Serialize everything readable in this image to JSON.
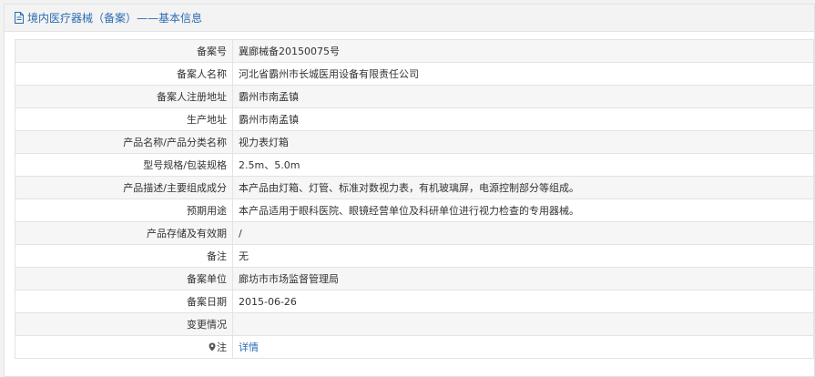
{
  "header": {
    "title": "境内医疗器械（备案）——基本信息"
  },
  "rows": [
    {
      "label": "备案号",
      "value": "冀廊械备20150075号"
    },
    {
      "label": "备案人名称",
      "value": "河北省霸州市长城医用设备有限责任公司"
    },
    {
      "label": "备案人注册地址",
      "value": "霸州市南孟镇"
    },
    {
      "label": "生产地址",
      "value": "霸州市南孟镇"
    },
    {
      "label": "产品名称/产品分类名称",
      "value": "视力表灯箱"
    },
    {
      "label": "型号规格/包装规格",
      "value": "2.5m、5.0m"
    },
    {
      "label": "产品描述/主要组成成分",
      "value": "本产品由灯箱、灯管、标准对数视力表，有机玻璃屏，电源控制部分等组成。"
    },
    {
      "label": "预期用途",
      "value": "本产品适用于眼科医院、眼镜经营单位及科研单位进行视力检查的专用器械。"
    },
    {
      "label": "产品存储及有效期",
      "value": "/"
    },
    {
      "label": "备注",
      "value": "无"
    },
    {
      "label": "备案单位",
      "value": "廊坊市市场监督管理局"
    },
    {
      "label": "备案日期",
      "value": "2015-06-26"
    },
    {
      "label": "变更情况",
      "value": ""
    },
    {
      "label": "注",
      "value": "详情"
    }
  ],
  "icons": {
    "header_icon": "document-icon",
    "note_icon": "map-pin-icon"
  },
  "colors": {
    "link": "#2b6cb3",
    "row_alt": "#f6f6f6",
    "border": "#e3e3e3"
  }
}
